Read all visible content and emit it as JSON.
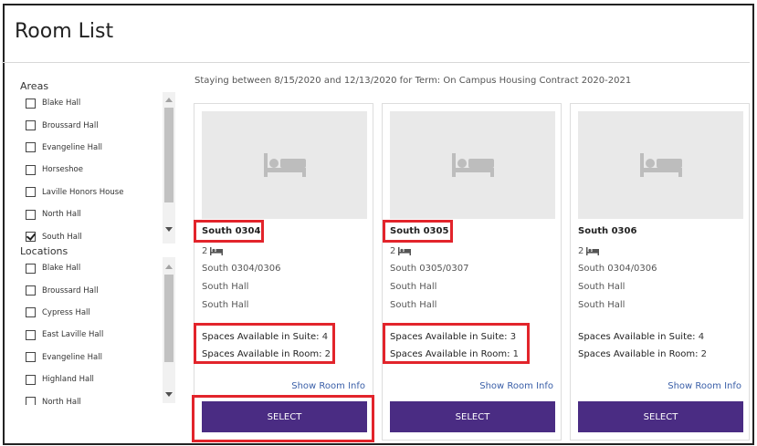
{
  "page": {
    "title": "Room List"
  },
  "areas": {
    "heading": "Areas",
    "items": [
      {
        "label": "Blake Hall",
        "checked": false
      },
      {
        "label": "Broussard Hall",
        "checked": false
      },
      {
        "label": "Evangeline Hall",
        "checked": false
      },
      {
        "label": "Horseshoe",
        "checked": false
      },
      {
        "label": "Laville Honors House",
        "checked": false
      },
      {
        "label": "North Hall",
        "checked": false
      },
      {
        "label": "South Hall",
        "checked": true
      }
    ]
  },
  "locations": {
    "heading": "Locations",
    "items": [
      {
        "label": "Blake Hall",
        "checked": false
      },
      {
        "label": "Broussard Hall",
        "checked": false
      },
      {
        "label": "Cypress Hall",
        "checked": false
      },
      {
        "label": "East Laville Hall",
        "checked": false
      },
      {
        "label": "Evangeline Hall",
        "checked": false
      },
      {
        "label": "Highland Hall",
        "checked": false
      },
      {
        "label": "North Hall",
        "checked": false
      }
    ]
  },
  "stay": {
    "text": "Staying between 8/15/2020 and 12/13/2020 for Term: On Campus Housing Contract 2020-2021"
  },
  "rooms": [
    {
      "name": "South 0304",
      "beds": "2",
      "suite": "South 0304/0306",
      "hall": "South Hall",
      "building": "South Hall",
      "suite_label": "Spaces Available in Suite:",
      "suite_count": "4",
      "room_label": "Spaces Available in Room:",
      "room_count": "2",
      "info_link": "Show Room Info",
      "select_label": "SELECT"
    },
    {
      "name": "South 0305",
      "beds": "2",
      "suite": "South 0305/0307",
      "hall": "South Hall",
      "building": "South Hall",
      "suite_label": "Spaces Available in Suite:",
      "suite_count": "3",
      "room_label": "Spaces Available in Room:",
      "room_count": "1",
      "info_link": "Show Room Info",
      "select_label": "SELECT"
    },
    {
      "name": "South 0306",
      "beds": "2",
      "suite": "South 0304/0306",
      "hall": "South Hall",
      "building": "South Hall",
      "suite_label": "Spaces Available in Suite:",
      "suite_count": "4",
      "room_label": "Spaces Available in Room:",
      "room_count": "2",
      "info_link": "Show Room Info",
      "select_label": "SELECT"
    }
  ],
  "icons": {
    "placeholder": "bed-icon",
    "beds": "bed-icon"
  },
  "colors": {
    "primary": "#4a2c83",
    "link": "#3a5fa8",
    "highlight": "#e2242b",
    "placeholder_bg": "#e9e9e9",
    "icon": "#bdbdbd"
  }
}
